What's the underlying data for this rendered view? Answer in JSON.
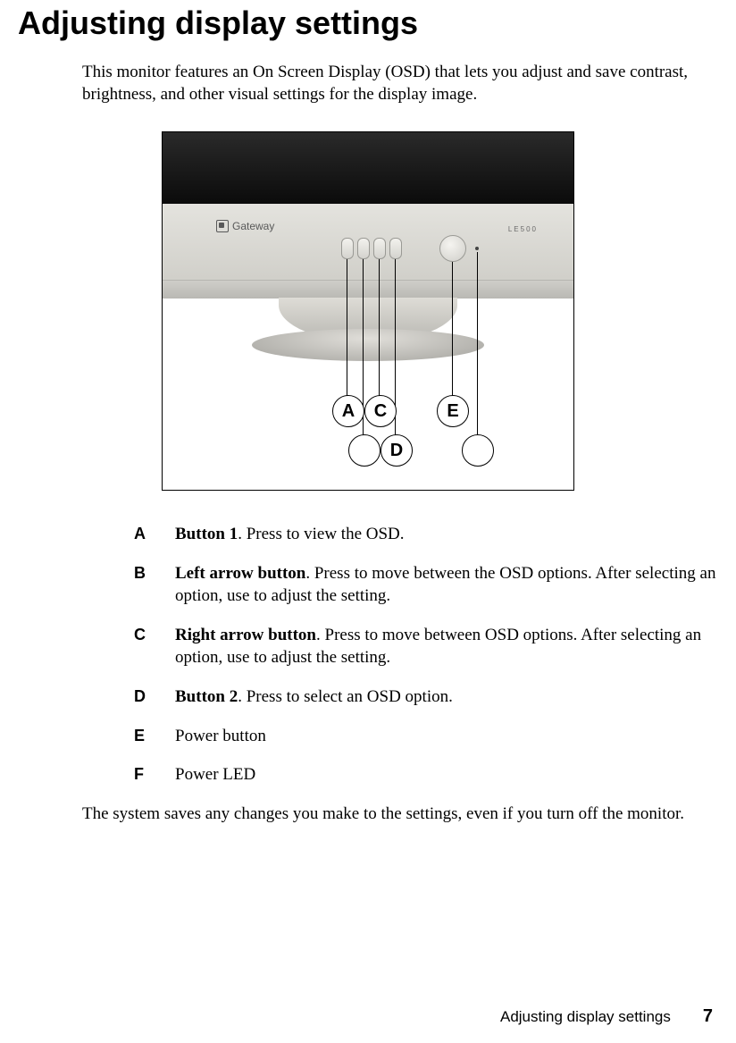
{
  "heading": "Adjusting display settings",
  "intro": "This monitor features an On Screen Display (OSD) that lets you adjust and save contrast, brightness, and other visual settings for the display image.",
  "figure": {
    "brand": "Gateway",
    "model": "LE500",
    "labels": {
      "a": "A",
      "b": "",
      "c": "C",
      "d": "D",
      "e": "E",
      "f": ""
    }
  },
  "legend": [
    {
      "letter": "A",
      "term": "Button 1",
      "text": ". Press to view the OSD."
    },
    {
      "letter": "B",
      "term": "Left arrow button",
      "text": ". Press to move between the OSD options. After selecting an option, use to adjust the setting."
    },
    {
      "letter": "C",
      "term": "Right arrow button",
      "text": ". Press to move between OSD options. After selecting an option, use to adjust the setting."
    },
    {
      "letter": "D",
      "term": "Button 2",
      "text": ". Press to select an OSD option."
    },
    {
      "letter": "E",
      "term": "",
      "text": "Power button"
    },
    {
      "letter": "F",
      "term": "",
      "text": "Power LED"
    }
  ],
  "closing": "The system saves any changes you make to the settings, even if you turn off the monitor.",
  "footer": {
    "section": "Adjusting display settings",
    "page": "7"
  }
}
